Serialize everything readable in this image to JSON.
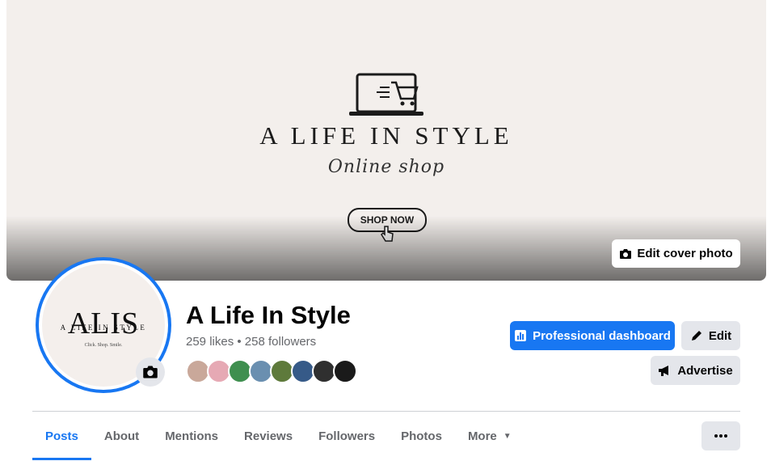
{
  "cover": {
    "brand_text": "A LIFE IN STYLE",
    "script_text": "Online shop",
    "shop_button": "SHOP NOW",
    "edit_cover_label": "Edit cover photo"
  },
  "avatar": {
    "monogram": "ALIS",
    "line": "A LIFE IN STYLE",
    "tagline": "Click. Shop. Smile."
  },
  "profile": {
    "name": "A Life In Style",
    "stats": "259 likes • 258 followers",
    "follower_faces": [
      "#c9a89a",
      "#e6a9b4",
      "#3f8f4f",
      "#6a8fb0",
      "#5e7a3b",
      "#365a88",
      "#2f2f2f",
      "#1a1a1a"
    ]
  },
  "actions": {
    "dashboard": "Professional dashboard",
    "edit": "Edit",
    "advertise": "Advertise"
  },
  "tabs": [
    "Posts",
    "About",
    "Mentions",
    "Reviews",
    "Followers",
    "Photos",
    "More"
  ],
  "colors": {
    "accent": "#1877f2",
    "gray_button": "#e4e6eb",
    "secondary_text": "#65676b"
  }
}
